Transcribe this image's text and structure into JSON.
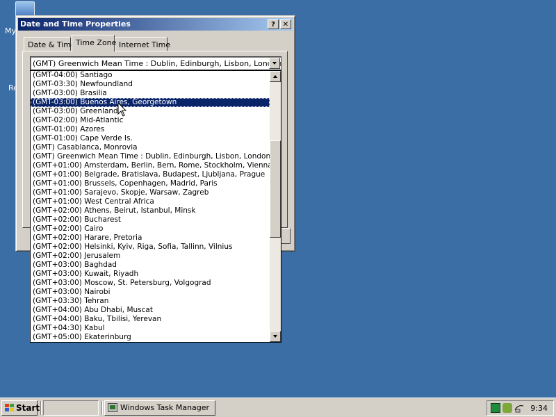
{
  "desktop": {
    "icon_label_1": "My",
    "icon_label_2": "Re"
  },
  "window": {
    "title": "Date and Time Properties",
    "help_glyph": "?",
    "close_glyph": "✕",
    "tabs": [
      {
        "label": "Date & Time"
      },
      {
        "label": "Time Zone"
      },
      {
        "label": "Internet Time"
      }
    ]
  },
  "timezone": {
    "selected_value": "(GMT) Greenwich Mean Time : Dublin, Edinburgh, Lisbon, London",
    "highlighted_item": "(GMT-03:00) Buenos Aires, Georgetown",
    "items": [
      "(GMT-04:00) Santiago",
      "(GMT-03:30) Newfoundland",
      "(GMT-03:00) Brasilia",
      "(GMT-03:00) Buenos Aires, Georgetown",
      "(GMT-03:00) Greenland",
      "(GMT-02:00) Mid-Atlantic",
      "(GMT-01:00) Azores",
      "(GMT-01:00) Cape Verde Is.",
      "(GMT) Casablanca, Monrovia",
      "(GMT) Greenwich Mean Time : Dublin, Edinburgh, Lisbon, London",
      "(GMT+01:00) Amsterdam, Berlin, Bern, Rome, Stockholm, Vienna",
      "(GMT+01:00) Belgrade, Bratislava, Budapest, Ljubljana, Prague",
      "(GMT+01:00) Brussels, Copenhagen, Madrid, Paris",
      "(GMT+01:00) Sarajevo, Skopje, Warsaw, Zagreb",
      "(GMT+01:00) West Central Africa",
      "(GMT+02:00) Athens, Beirut, Istanbul, Minsk",
      "(GMT+02:00) Bucharest",
      "(GMT+02:00) Cairo",
      "(GMT+02:00) Harare, Pretoria",
      "(GMT+02:00) Helsinki, Kyiv, Riga, Sofia, Tallinn, Vilnius",
      "(GMT+02:00) Jerusalem",
      "(GMT+03:00) Baghdad",
      "(GMT+03:00) Kuwait, Riyadh",
      "(GMT+03:00) Moscow, St. Petersburg, Volgograd",
      "(GMT+03:00) Nairobi",
      "(GMT+03:30) Tehran",
      "(GMT+04:00) Abu Dhabi, Muscat",
      "(GMT+04:00) Baku, Tbilisi, Yerevan",
      "(GMT+04:30) Kabul",
      "(GMT+05:00) Ekaterinburg"
    ]
  },
  "taskbar": {
    "start_label": "Start",
    "task_button_label": "Windows Task Manager",
    "clock": "9:34"
  },
  "colors": {
    "desktop": "#3a6ea5",
    "title_active_start": "#0a246a",
    "title_active_end": "#a6caf0",
    "selection": "#0a246a",
    "face": "#d4d0c8"
  }
}
